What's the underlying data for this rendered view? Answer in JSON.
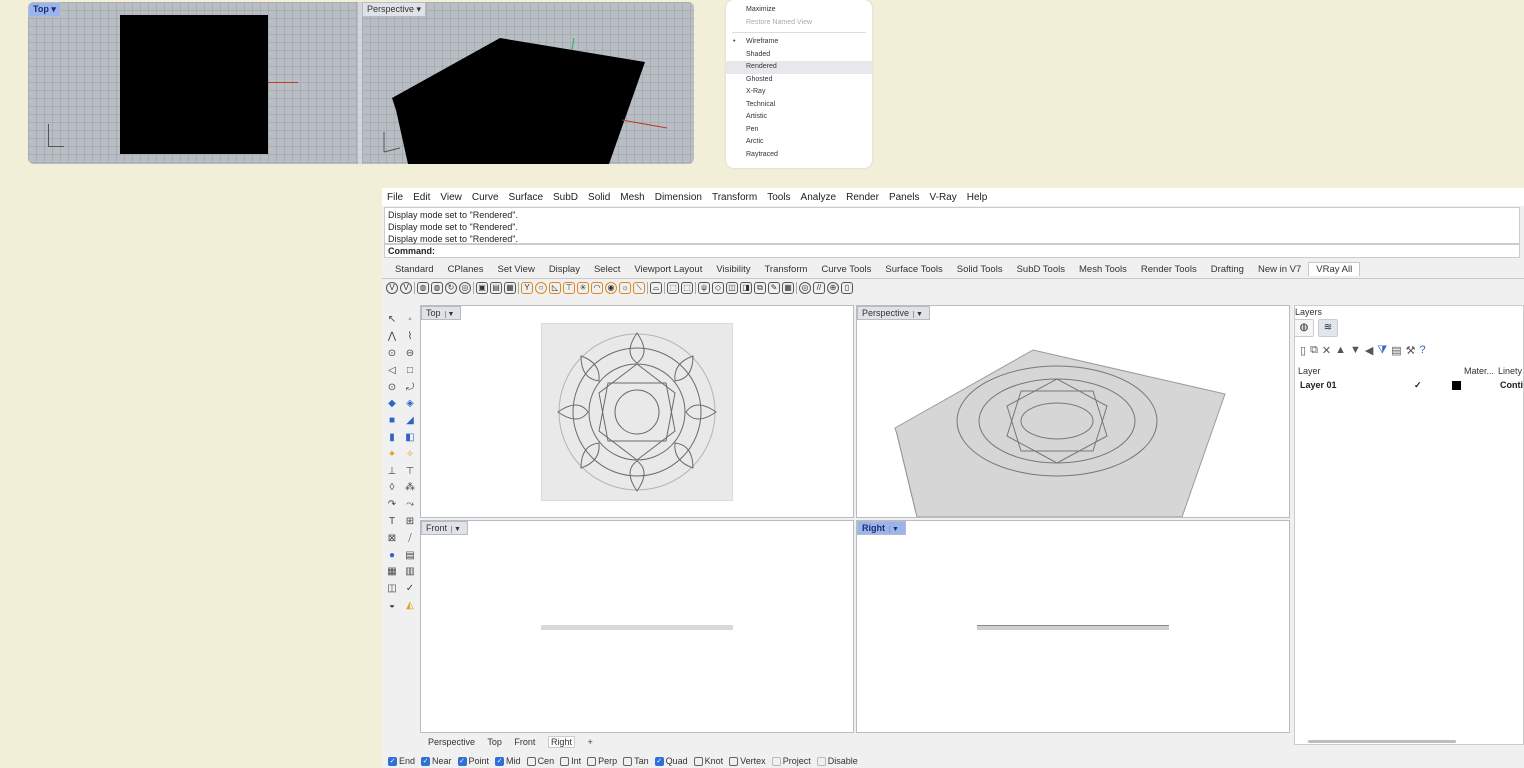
{
  "thumbnails": {
    "top_label": "Top",
    "perspective_label": "Perspective"
  },
  "display_menu": {
    "items": [
      {
        "label": "Maximize",
        "state": "normal"
      },
      {
        "label": "Restore Named View",
        "state": "disabled"
      },
      {
        "label": "Wireframe",
        "state": "checked"
      },
      {
        "label": "Shaded",
        "state": "normal"
      },
      {
        "label": "Rendered",
        "state": "highlight"
      },
      {
        "label": "Ghosted",
        "state": "normal"
      },
      {
        "label": "X-Ray",
        "state": "normal"
      },
      {
        "label": "Technical",
        "state": "normal"
      },
      {
        "label": "Artistic",
        "state": "normal"
      },
      {
        "label": "Pen",
        "state": "normal"
      },
      {
        "label": "Arctic",
        "state": "normal"
      },
      {
        "label": "Raytraced",
        "state": "normal"
      }
    ]
  },
  "menubar": [
    "File",
    "Edit",
    "View",
    "Curve",
    "Surface",
    "SubD",
    "Solid",
    "Mesh",
    "Dimension",
    "Transform",
    "Tools",
    "Analyze",
    "Render",
    "Panels",
    "V-Ray",
    "Help"
  ],
  "history": [
    "Display mode set to \"Rendered\".",
    "Display mode set to \"Rendered\".",
    "Display mode set to \"Rendered\"."
  ],
  "command_label": "Command:",
  "toolbar_tabs": [
    "Standard",
    "CPlanes",
    "Set View",
    "Display",
    "Select",
    "Viewport Layout",
    "Visibility",
    "Transform",
    "Curve Tools",
    "Surface Tools",
    "Solid Tools",
    "SubD Tools",
    "Mesh Tools",
    "Render Tools",
    "Drafting",
    "New in V7",
    "VRay All"
  ],
  "active_tab": "VRay All",
  "viewports": {
    "top": "Top",
    "perspective": "Perspective",
    "front": "Front",
    "right": "Right"
  },
  "viewport_tabs": [
    "Perspective",
    "Top",
    "Front",
    "Right"
  ],
  "snaps": [
    {
      "label": "End",
      "checked": true
    },
    {
      "label": "Near",
      "checked": true
    },
    {
      "label": "Point",
      "checked": true
    },
    {
      "label": "Mid",
      "checked": true
    },
    {
      "label": "Cen",
      "checked": false
    },
    {
      "label": "Int",
      "checked": false
    },
    {
      "label": "Perp",
      "checked": false
    },
    {
      "label": "Tan",
      "checked": false
    },
    {
      "label": "Quad",
      "checked": true
    },
    {
      "label": "Knot",
      "checked": false
    },
    {
      "label": "Vertex",
      "checked": false
    },
    {
      "label": "Project",
      "checked": false,
      "disabled": true
    },
    {
      "label": "Disable",
      "checked": false,
      "disabled": true
    }
  ],
  "layers_panel": {
    "title": "Layers",
    "col_layer": "Layer",
    "col_material": "Mater...",
    "col_linetype": "Linety",
    "row": {
      "name": "Layer 01",
      "linetype": "Conti"
    }
  },
  "colors": {
    "active_viewport_label": "#9cb4ee",
    "accent": "#2f6fd6",
    "background": "#f2efd8"
  }
}
